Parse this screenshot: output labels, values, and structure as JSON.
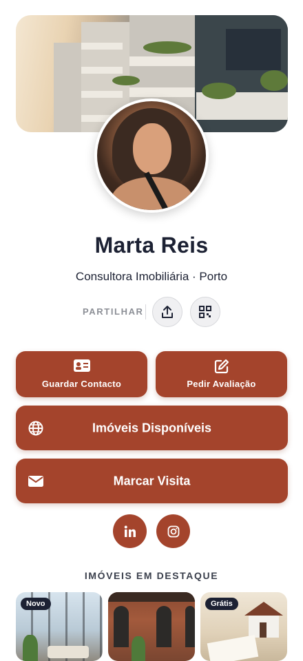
{
  "profile": {
    "name": "Marta Reis",
    "subtitle": "Consultora Imobiliária · Porto"
  },
  "share": {
    "label": "PARTILHAR",
    "icons": [
      "share-upload-icon",
      "qr-code-icon"
    ]
  },
  "actions": {
    "save_contact": "Guardar Contacto",
    "request_valuation": "Pedir Avaliação",
    "available_properties": "Imóveis Disponíveis",
    "book_visit": "Marcar Visita"
  },
  "social": [
    "linkedin-icon",
    "instagram-icon"
  ],
  "featured": {
    "title": "IMÓVEIS EM DESTAQUE",
    "cards": [
      {
        "tag": "Novo"
      },
      {
        "tag": ""
      },
      {
        "tag": "Grátis"
      }
    ]
  },
  "colors": {
    "accent": "#a4442c",
    "text": "#1c2133",
    "muted": "#8c8f96"
  }
}
